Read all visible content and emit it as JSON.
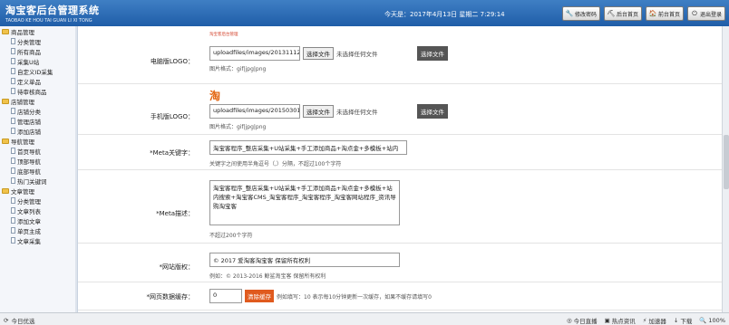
{
  "header": {
    "title": "淘宝客后台管理系统",
    "subtitle": "TAOBAO KE HOU TAI GUAN LI XI TONG",
    "today_label": "今天是：2017年4月13日 星期二 7:29:14",
    "buttons": [
      {
        "label": "修改密码",
        "icon": "🔧"
      },
      {
        "label": "后台首页",
        "icon": "⛏"
      },
      {
        "label": "前台首页",
        "icon": "🏠"
      },
      {
        "label": "退出登录",
        "icon": "⏻"
      }
    ]
  },
  "sidebar": {
    "groups": [
      {
        "title": "商品管理",
        "items": [
          "分类管理",
          "所有商品",
          "采集U站",
          "自定义ID采集",
          "定义单品",
          "待审核商品"
        ]
      },
      {
        "title": "店铺管理",
        "items": [
          "店铺分类",
          "管理店铺",
          "添加店铺"
        ]
      },
      {
        "title": "导航管理",
        "items": [
          "首页导航",
          "顶部导航",
          "底部导航",
          "热门关键词"
        ]
      },
      {
        "title": "文章管理",
        "items": [
          "分类管理",
          "文章列表",
          "添加文章",
          "单页主成",
          "文章采集"
        ]
      }
    ]
  },
  "form": {
    "pc_logo": {
      "label": "电脑版LOGO：",
      "preview": "淘宝客后台管理",
      "path": "uploadfiles/images/20131112/c",
      "choose": "选择文件",
      "no_file": "未选择任何文件",
      "upload": "选择文件",
      "format": "图片格式：gif|jpg|png"
    },
    "mobile_logo": {
      "label": "手机版LOGO：",
      "preview": "淘",
      "path": "uploadfiles/images/20150301/fe",
      "choose": "选择文件",
      "no_file": "未选择任何文件",
      "upload": "选择文件",
      "format": "图片格式：gif|jpg|png"
    },
    "meta_keywords": {
      "label": "*Meta关键字：",
      "value": "淘宝客程序_整店采集+U站采集+手工添加商品+淘点金+多模板+站内",
      "hint": "关键字之间使用半角逗号（,）分隔，不超过100个字符"
    },
    "meta_desc": {
      "label": "*Meta描述：",
      "value": "淘宝客程序_整店采集+U站采集+手工添加商品+淘点金+多模板+站内搜索+淘宝客CMS_淘宝客程序_淘宝客程序_淘宝客网站程序_资讯导购淘宝客",
      "hint": "不超过200个字符"
    },
    "copyright": {
      "label": "*网站版权：",
      "value": "© 2017 爱淘客淘宝客 保留所有权利",
      "hint": "例如：© 2013-2016 鲸鲨淘宝客 保留所有权利"
    },
    "cache": {
      "label": "*网页数据缓存：",
      "value": "0",
      "clear": "清除缓存",
      "hint": "例如填写：10 表示每10分钟更新一次缓存，如果不缓存请填写0"
    }
  },
  "statusbar": {
    "left": "今日优选",
    "items": [
      "今日直播",
      "热点资讯",
      "加速器",
      "下载",
      "100%"
    ]
  }
}
